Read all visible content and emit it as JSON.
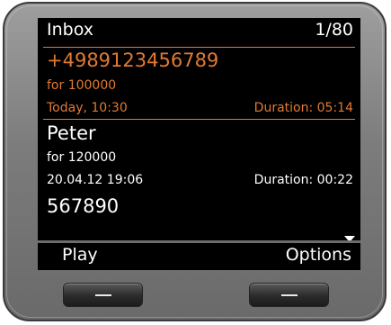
{
  "header": {
    "title": "Inbox",
    "counter": "1/80"
  },
  "messages": [
    {
      "caller": "+4989123456789",
      "for_label": "for 100000",
      "datetime": "Today, 10:30",
      "duration": "Duration: 05:14",
      "selected": true
    },
    {
      "caller": "Peter",
      "for_label": "for 120000",
      "datetime": "20.04.12 19:06",
      "duration": "Duration: 00:22",
      "selected": false
    },
    {
      "caller": "567890",
      "selected": false
    }
  ],
  "softkeys": {
    "left": "Play",
    "right": "Options"
  },
  "icons": {
    "scroll": "scroll-down-arrow-icon",
    "hw_key": "minus-icon"
  },
  "colors": {
    "accent": "#e07a33",
    "screen_bg": "#000000",
    "text": "#ffffff"
  }
}
